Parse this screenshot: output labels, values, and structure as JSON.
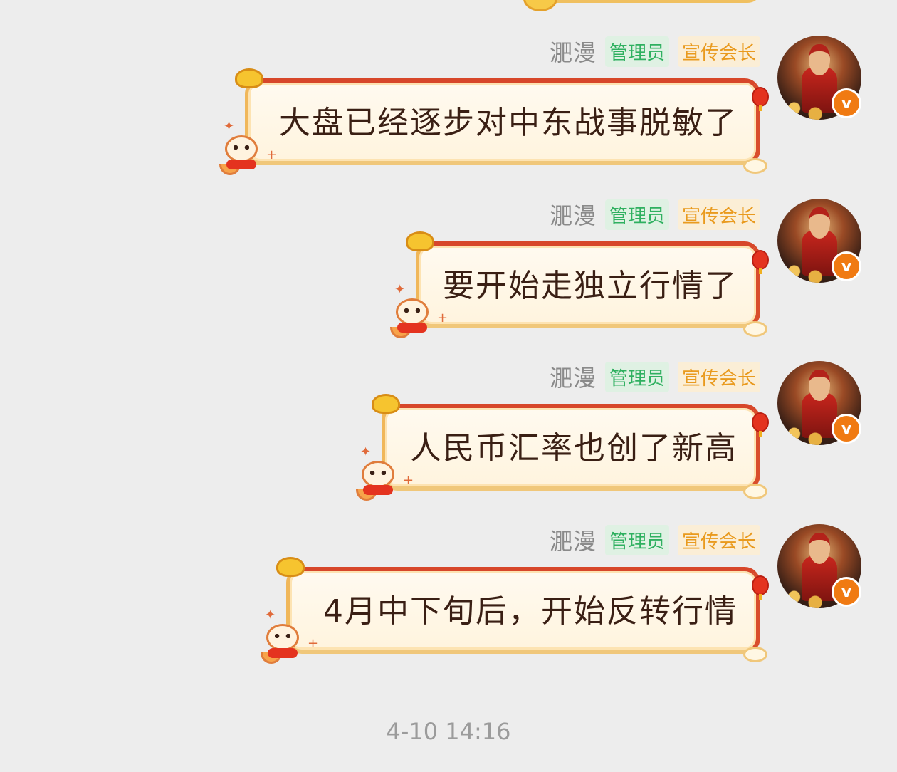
{
  "messages": [
    {
      "sender": "淝漫",
      "badges": {
        "admin": "管理员",
        "title": "宣传会长"
      },
      "text": "大盘已经逐步对中东战事脱敏了"
    },
    {
      "sender": "淝漫",
      "badges": {
        "admin": "管理员",
        "title": "宣传会长"
      },
      "text": "要开始走独立行情了"
    },
    {
      "sender": "淝漫",
      "badges": {
        "admin": "管理员",
        "title": "宣传会长"
      },
      "text": "人民币汇率也创了新高"
    },
    {
      "sender": "淝漫",
      "badges": {
        "admin": "管理员",
        "title": "宣传会长"
      },
      "text": "4月中下旬后，开始反转行情"
    }
  ],
  "timestamp": "4-10 14:16",
  "avatar_badge": "v",
  "colors": {
    "background": "#ededed",
    "admin_badge_text": "#2fb060",
    "title_badge_text": "#e99a1e",
    "bubble_border": "#d7472a",
    "verified_badge": "#f07a12"
  }
}
